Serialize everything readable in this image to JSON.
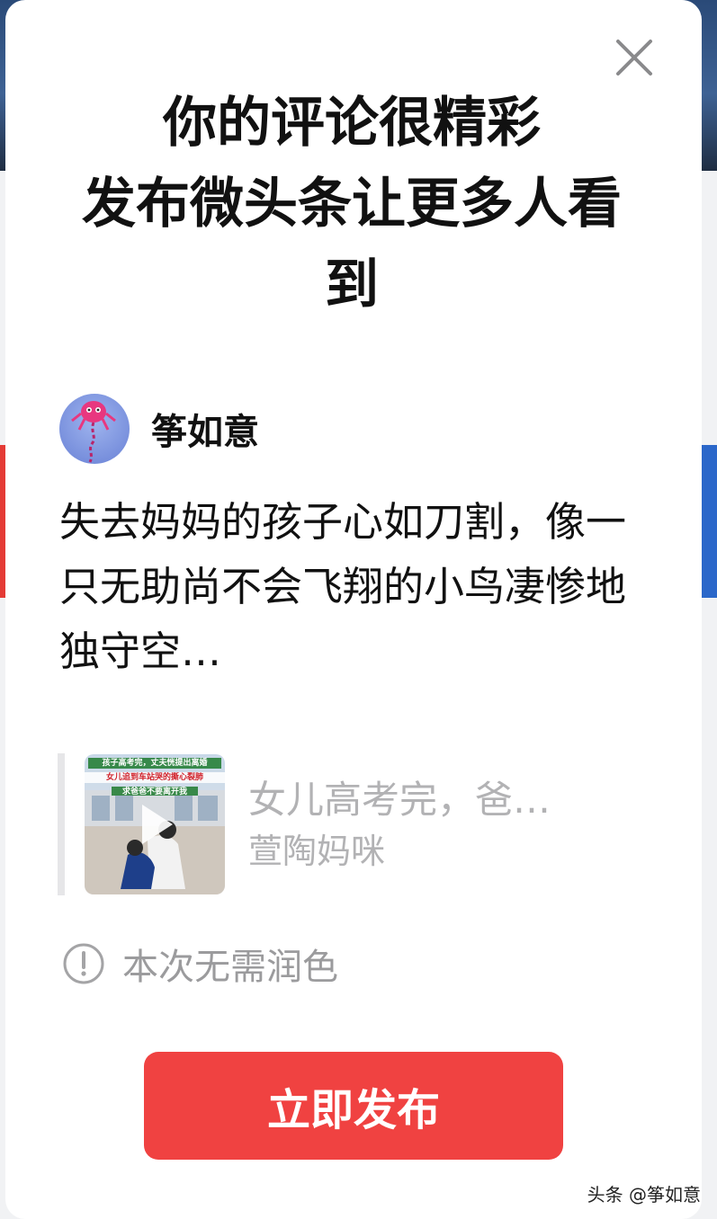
{
  "dialog": {
    "headline_lines": [
      "你的评论很精彩",
      "发布微头条让更多人看",
      "到"
    ],
    "close_icon": "close-icon"
  },
  "author": {
    "name": "筝如意",
    "avatar_icon": "kite-avatar"
  },
  "comment": {
    "text": "失去妈妈的孩子心如刀割，像一只无助尚不会飞翔的小鸟凄惨地独守空…"
  },
  "quoted_post": {
    "title": "女儿高考完，爸…",
    "author": "萱陶妈咪",
    "thumb_caption_line1": "孩子高考完，丈夫恍提出离婚",
    "thumb_caption_line2": "女儿追到车站哭的撕心裂肺",
    "thumb_caption_line3": "求爸爸不要离开我",
    "thumb_icon": "play-icon"
  },
  "hint": {
    "text": "本次无需润色",
    "icon": "info-circle-icon"
  },
  "publish_button": {
    "label": "立即发布"
  },
  "watermark": {
    "text": "头条 @筝如意"
  },
  "colors": {
    "primary_button": "#f04241",
    "muted_text": "#9b9b9d",
    "quote_text": "#b2b2b4"
  }
}
